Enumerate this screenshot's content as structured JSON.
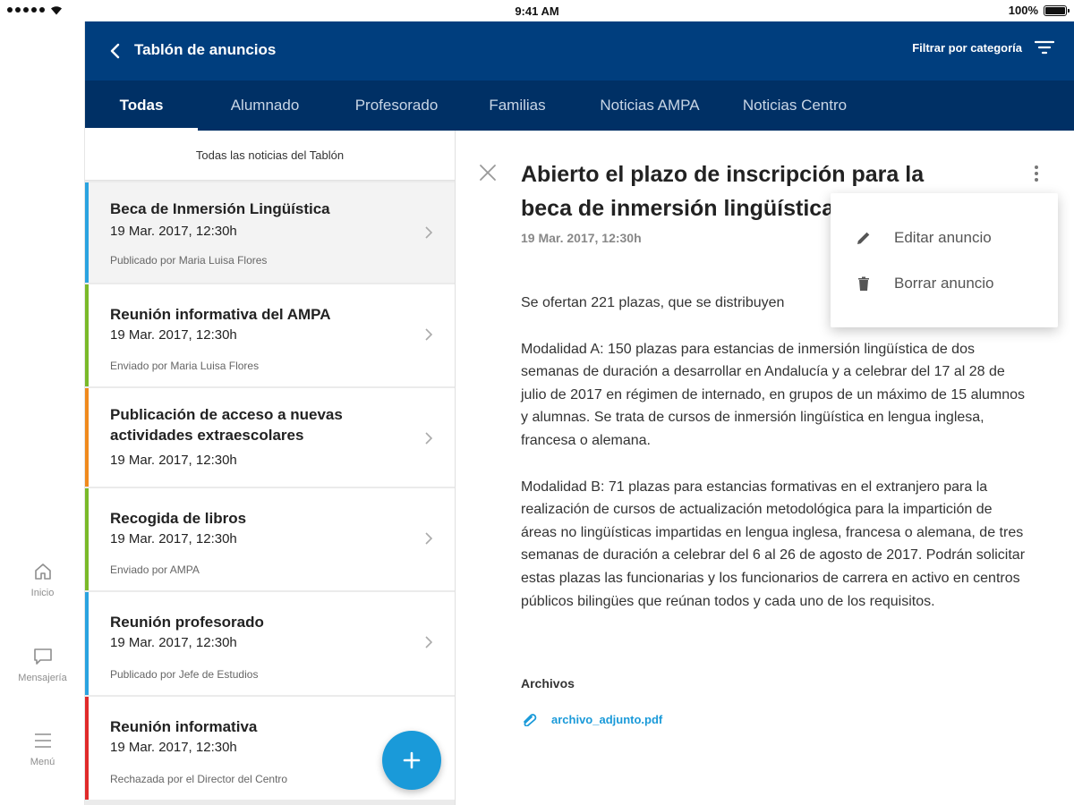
{
  "status_bar": {
    "time": "9:41 AM",
    "battery": "100%"
  },
  "rail": {
    "items": [
      {
        "label": "Inicio",
        "icon": "home-icon"
      },
      {
        "label": "Mensajería",
        "icon": "chat-icon"
      },
      {
        "label": "Menú",
        "icon": "menu-icon"
      }
    ]
  },
  "header": {
    "title": "Tablón de anuncios",
    "filter_label": "Filtrar por categoría"
  },
  "tabs": [
    {
      "label": "Todas",
      "active": true
    },
    {
      "label": "Alumnado"
    },
    {
      "label": "Profesorado"
    },
    {
      "label": "Familias"
    },
    {
      "label": "Noticias AMPA"
    },
    {
      "label": "Noticias Centro"
    }
  ],
  "list": {
    "header": "Todas las noticias del Tablón",
    "items": [
      {
        "title": "Beca de Inmersión Lingüística",
        "date": "19 Mar. 2017,  12:30h",
        "author": "Publicado por Maria Luisa Flores",
        "color": "#2aa3e0"
      },
      {
        "title": "Reunión informativa del AMPA",
        "date": "19 Mar. 2017,  12:30h",
        "author": "Enviado por Maria Luisa Flores",
        "color": "#7ab929"
      },
      {
        "title": "Publicación de acceso a nuevas actividades extraescolares",
        "date": "19 Mar. 2017,  12:30h",
        "author": "",
        "color": "#f08a1d"
      },
      {
        "title": "Recogida de libros",
        "date": "19 Mar. 2017,  12:30h",
        "author": "Enviado por AMPA",
        "color": "#7ab929"
      },
      {
        "title": "Reunión profesorado",
        "date": "19 Mar. 2017,  12:30h",
        "author": "Publicado por Jefe de Estudios",
        "color": "#2aa3e0"
      },
      {
        "title": "Reunión informativa",
        "date": "19 Mar. 2017,  12:30h",
        "author": "Rechazada por el Director del Centro",
        "color": "#e02a2a"
      }
    ]
  },
  "detail": {
    "title": "Abierto el plazo de inscripción para la beca de inmersión lingüística",
    "date": "19 Mar. 2017,  12:30h",
    "paragraphs": [
      "Se ofertan 221 plazas, que se distribuyen",
      "Modalidad A:  150 plazas para estancias de inmersión lingüística de dos semanas de duración a desarrollar en Andalucía y a celebrar del 17 al 28 de julio de 2017 en régimen de internado, en grupos de un máximo de 15 alumnos y alumnas. Se trata de cursos de inmersión lingüística en lengua inglesa, francesa o alemana.",
      "Modalidad B:  71 plazas para estancias formativas en el extranjero para la realización de cursos de actualización metodológica para la impartición de áreas no lingüísticas impartidas en lengua inglesa, francesa o alemana, de tres semanas de duración a celebrar del 6 al 26 de agosto de 2017. Podrán solicitar estas plazas las funcionarias y los funcionarios de carrera en activo en centros públicos bilingües que reúnan todos y cada uno de los requisitos."
    ],
    "attachments_heading": "Archivos",
    "attachment": "archivo_adjunto.pdf"
  },
  "menu": {
    "edit": "Editar anuncio",
    "delete": "Borrar anuncio"
  },
  "colors": {
    "header": "#003e7e",
    "tabs": "#003065",
    "accent": "#1a9ad9"
  }
}
